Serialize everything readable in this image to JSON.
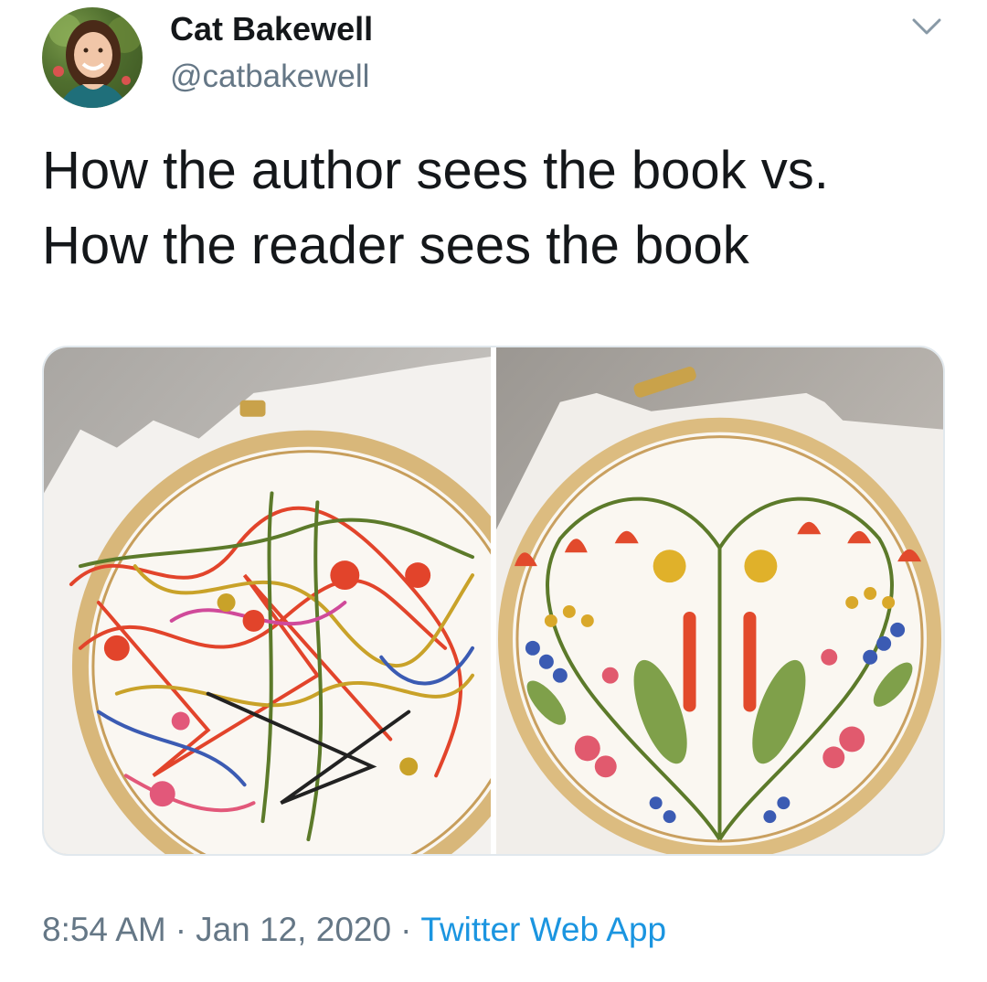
{
  "tweet": {
    "author_name": "Cat Bakewell",
    "author_handle": "@catbakewell",
    "text": "How the author sees the book vs.\nHow the reader sees the book",
    "time": "8:54 AM",
    "date": "Jan 12, 2020",
    "source": "Twitter Web App",
    "separator": "·"
  },
  "icons": {
    "menu": "chevron-down-icon",
    "avatar": "profile-photo"
  },
  "media": [
    {
      "name": "messy-embroidery-back"
    },
    {
      "name": "neat-embroidery-front"
    }
  ],
  "colors": {
    "text": "#14171a",
    "secondary": "#657786",
    "link": "#1b95e0",
    "border": "#e1e8ed"
  }
}
